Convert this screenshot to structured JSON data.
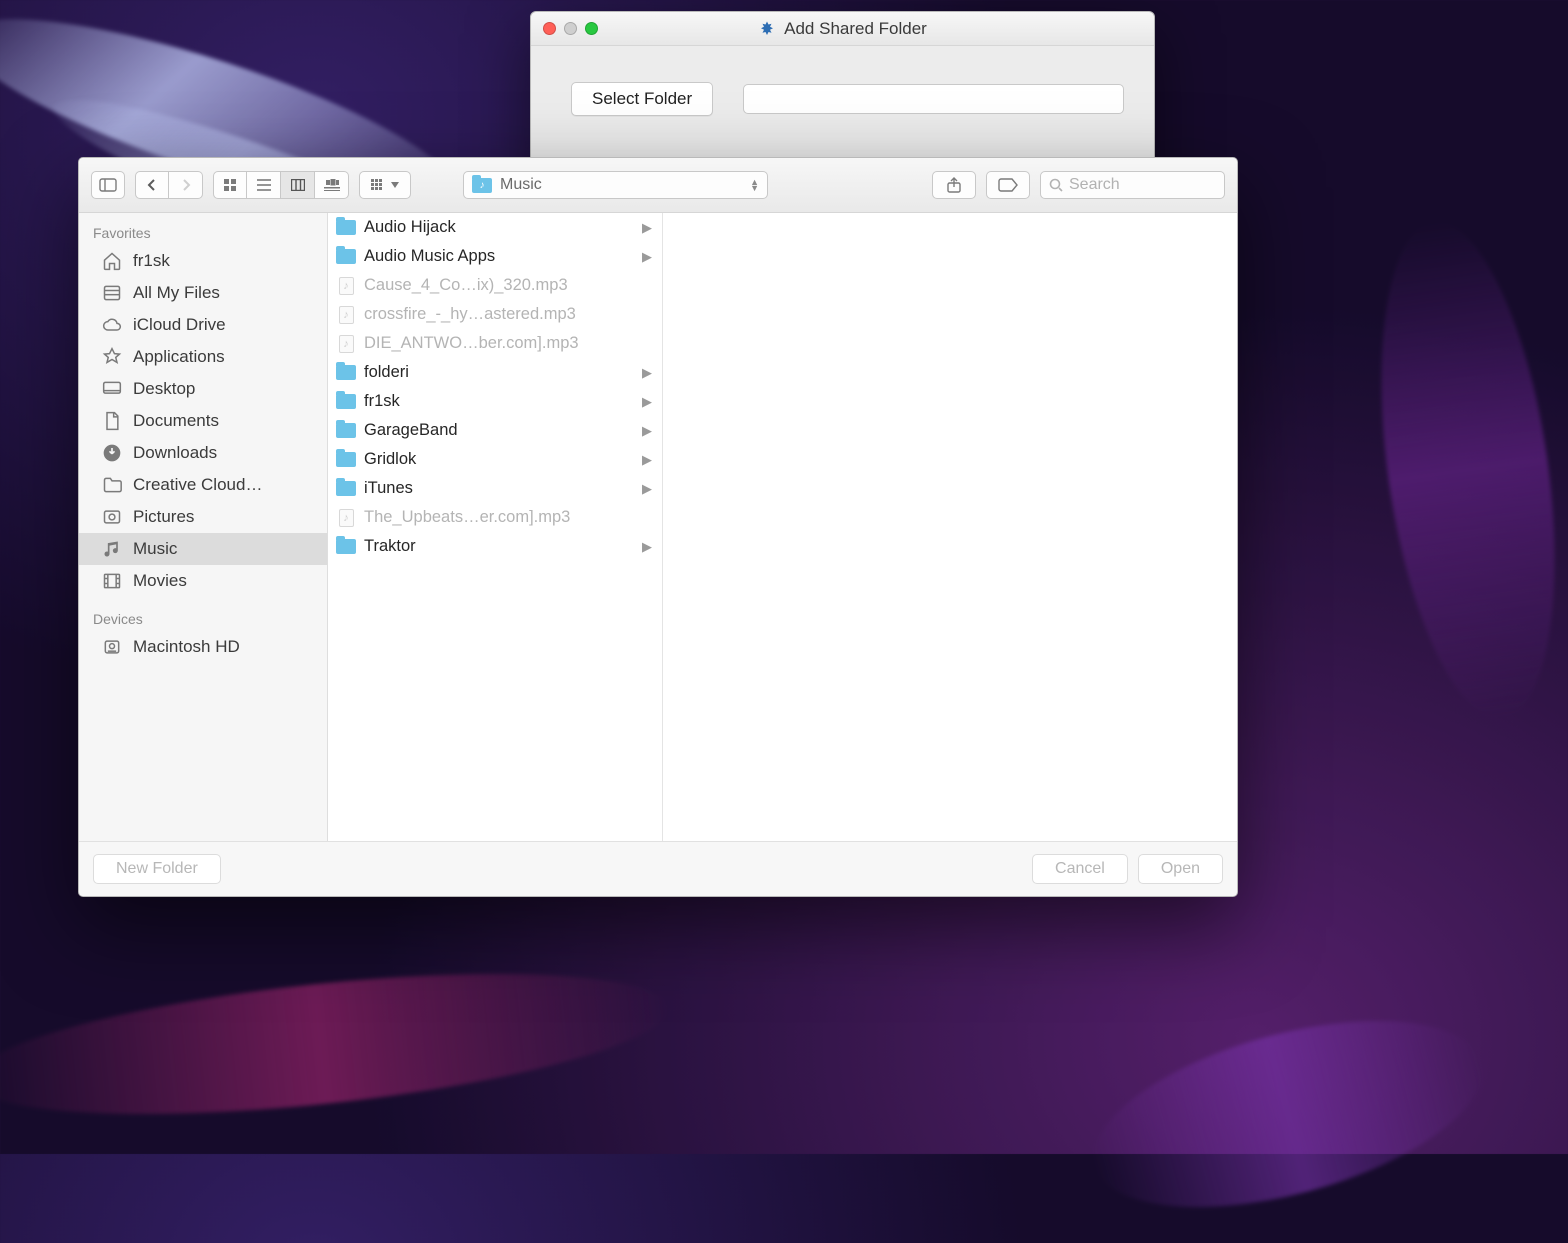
{
  "parent": {
    "title": "Add Shared Folder",
    "select_button": "Select Folder",
    "path_value": ""
  },
  "toolbar": {
    "location": "Music",
    "search_placeholder": "Search"
  },
  "sidebar": {
    "favorites_header": "Favorites",
    "devices_header": "Devices",
    "favorites": [
      {
        "icon": "home",
        "label": "fr1sk"
      },
      {
        "icon": "allmyfiles",
        "label": "All My Files"
      },
      {
        "icon": "cloud",
        "label": "iCloud Drive"
      },
      {
        "icon": "apps",
        "label": "Applications"
      },
      {
        "icon": "desktop",
        "label": "Desktop"
      },
      {
        "icon": "documents",
        "label": "Documents"
      },
      {
        "icon": "downloads",
        "label": "Downloads"
      },
      {
        "icon": "folder",
        "label": "Creative Cloud…"
      },
      {
        "icon": "pictures",
        "label": "Pictures"
      },
      {
        "icon": "music",
        "label": "Music",
        "selected": true
      },
      {
        "icon": "movies",
        "label": "Movies"
      }
    ],
    "devices": [
      {
        "icon": "hdd",
        "label": "Macintosh HD"
      }
    ]
  },
  "column": [
    {
      "type": "folder",
      "name": "Audio Hijack"
    },
    {
      "type": "folder",
      "name": "Audio Music Apps"
    },
    {
      "type": "file",
      "name": "Cause_4_Co…ix)_320.mp3"
    },
    {
      "type": "file",
      "name": "crossfire_-_hy…astered.mp3"
    },
    {
      "type": "file",
      "name": "DIE_ANTWO…ber.com].mp3"
    },
    {
      "type": "folder",
      "name": "folderi"
    },
    {
      "type": "folder",
      "name": "fr1sk"
    },
    {
      "type": "folder",
      "name": "GarageBand"
    },
    {
      "type": "folder",
      "name": "Gridlok"
    },
    {
      "type": "folder",
      "name": "iTunes"
    },
    {
      "type": "file",
      "name": "The_Upbeats…er.com].mp3"
    },
    {
      "type": "folder",
      "name": "Traktor"
    }
  ],
  "footer": {
    "new_folder": "New Folder",
    "cancel": "Cancel",
    "open": "Open"
  }
}
